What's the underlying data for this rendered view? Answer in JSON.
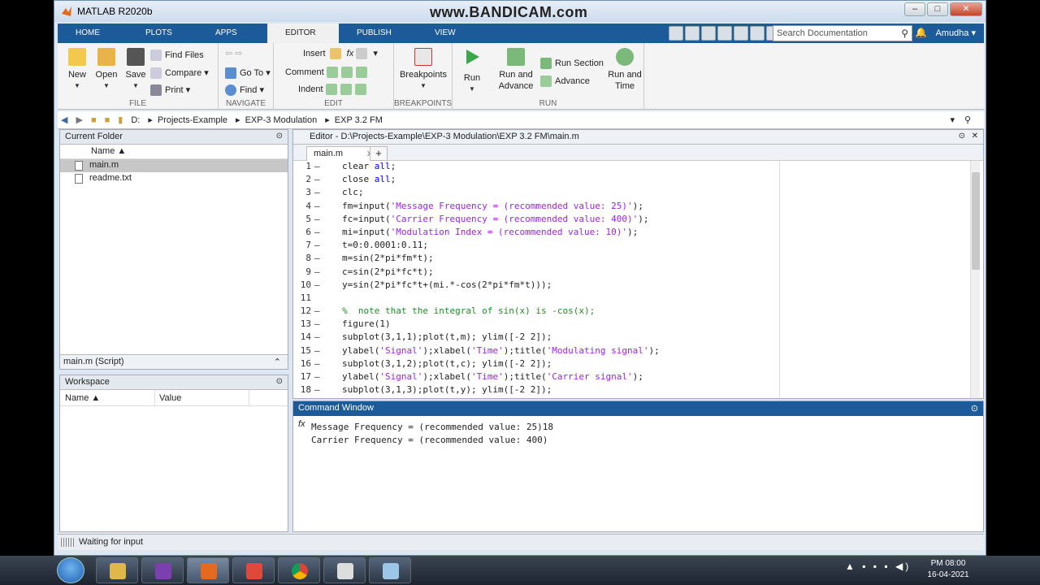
{
  "window_title": "MATLAB R2020b",
  "watermark": "www.BANDICAM.com",
  "tabs": [
    {
      "label": "HOME"
    },
    {
      "label": "PLOTS"
    },
    {
      "label": "APPS"
    },
    {
      "label": "EDITOR"
    },
    {
      "label": "PUBLISH"
    },
    {
      "label": "VIEW"
    }
  ],
  "search": {
    "placeholder": "Search Documentation"
  },
  "user": "Amudha",
  "ribbon": {
    "file": {
      "label": "FILE",
      "new": "New",
      "open": "Open",
      "save": "Save",
      "find_files": "Find Files",
      "compare": "Compare",
      "print": "Print"
    },
    "navigate": {
      "label": "NAVIGATE",
      "go_to": "Go To",
      "find": "Find"
    },
    "edit": {
      "label": "EDIT",
      "insert": "Insert",
      "comment": "Comment",
      "indent": "Indent",
      "fx": "fx"
    },
    "breakpoints": {
      "label": "BREAKPOINTS",
      "button": "Breakpoints"
    },
    "run": {
      "label": "RUN",
      "run": "Run",
      "run_and_advance_1": "Run and",
      "run_and_advance_2": "Advance",
      "run_section": "Run Section",
      "advance": "Advance",
      "run_and_time_1": "Run and",
      "run_and_time_2": "Time"
    }
  },
  "path": [
    "D:",
    "Projects-Example",
    "EXP-3 Modulation",
    "EXP 3.2 FM"
  ],
  "current_folder": {
    "title": "Current Folder",
    "col_name": "Name ▲",
    "files": [
      {
        "name": "main.m"
      },
      {
        "name": "readme.txt"
      }
    ],
    "details": "main.m  (Script)"
  },
  "workspace": {
    "title": "Workspace",
    "col_name": "Name ▲",
    "col_value": "Value"
  },
  "editor": {
    "title": "Editor - D:\\Projects-Example\\EXP-3 Modulation\\EXP 3.2 FM\\main.m",
    "tab": "main.m",
    "lines": [
      {
        "n": "1",
        "code": "clear all;"
      },
      {
        "n": "2",
        "code": "close all;"
      },
      {
        "n": "3",
        "code": "clc;"
      },
      {
        "n": "4",
        "code": "fm=input('Message Frequency = (recommended value: 25)');"
      },
      {
        "n": "5",
        "code": "fc=input('Carrier Frequency = (recommended value: 400)');"
      },
      {
        "n": "6",
        "code": "mi=input('Modulation Index = (recommended value: 10)');"
      },
      {
        "n": "7",
        "code": "t=0:0.0001:0.11;"
      },
      {
        "n": "8",
        "code": "m=sin(2*pi*fm*t);"
      },
      {
        "n": "9",
        "code": "c=sin(2*pi*fc*t);"
      },
      {
        "n": "10",
        "code": "y=sin(2*pi*fc*t+(mi.*-cos(2*pi*fm*t)));"
      },
      {
        "n": "11",
        "code": ""
      },
      {
        "n": "12",
        "code": "%  note that the integral of sin(x) is -cos(x);"
      },
      {
        "n": "13",
        "code": "figure(1)"
      },
      {
        "n": "14",
        "code": "subplot(3,1,1);plot(t,m); ylim([-2 2]);"
      },
      {
        "n": "15",
        "code": "ylabel('Signal');xlabel('Time');title('Modulating signal');"
      },
      {
        "n": "16",
        "code": "subplot(3,1,2);plot(t,c); ylim([-2 2]);"
      },
      {
        "n": "17",
        "code": "ylabel('Signal');xlabel('Time');title('Carrier signal');"
      },
      {
        "n": "18",
        "code": "subplot(3,1,3);plot(t,y); ylim([-2 2]);"
      }
    ]
  },
  "command_window": {
    "title": "Command Window",
    "line1": "Message Frequency = (recommended value: 25)18",
    "line2": "Carrier Frequency = (recommended value: 400)",
    "prompt": "fx"
  },
  "status": "Waiting for input",
  "clock": {
    "time": "PM 08:00",
    "date": "16-04-2021"
  }
}
